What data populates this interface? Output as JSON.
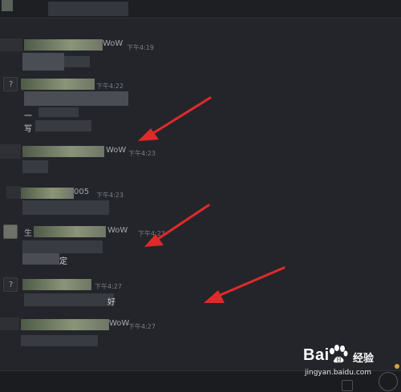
{
  "messages": [
    {
      "name_suffix": "",
      "time": "",
      "content": ""
    },
    {
      "name_suffix": "WoW",
      "time": "下午4:19",
      "content": ""
    },
    {
      "name_suffix": "",
      "time": "下午4:22",
      "content_lines": [
        "一",
        "写"
      ]
    },
    {
      "name_suffix": "WoW",
      "time": "下午4:23",
      "content": ""
    },
    {
      "name_suffix": "005",
      "time": "下午4:23",
      "content": ""
    },
    {
      "name_prefix": "生",
      "name_suffix": "WoW",
      "time": "下午4:23",
      "content": "定"
    },
    {
      "name_suffix": "",
      "time": "下午4:27",
      "content": "好"
    },
    {
      "name_suffix": "WoW",
      "time": "下午4:27",
      "content": ""
    }
  ],
  "watermark": {
    "logo_text": "Bai",
    "logo_text_2": "百",
    "name": "经验",
    "url": "jingyan.baidu.com"
  },
  "colors": {
    "background": "#23252a",
    "annotation_arrow": "#e02a2a",
    "time_text": "#7b7e84"
  },
  "icons": {
    "unknown_avatar": "question-mark-icon",
    "annotation": "red-arrow-icon"
  },
  "avatar_placeholder": "?"
}
